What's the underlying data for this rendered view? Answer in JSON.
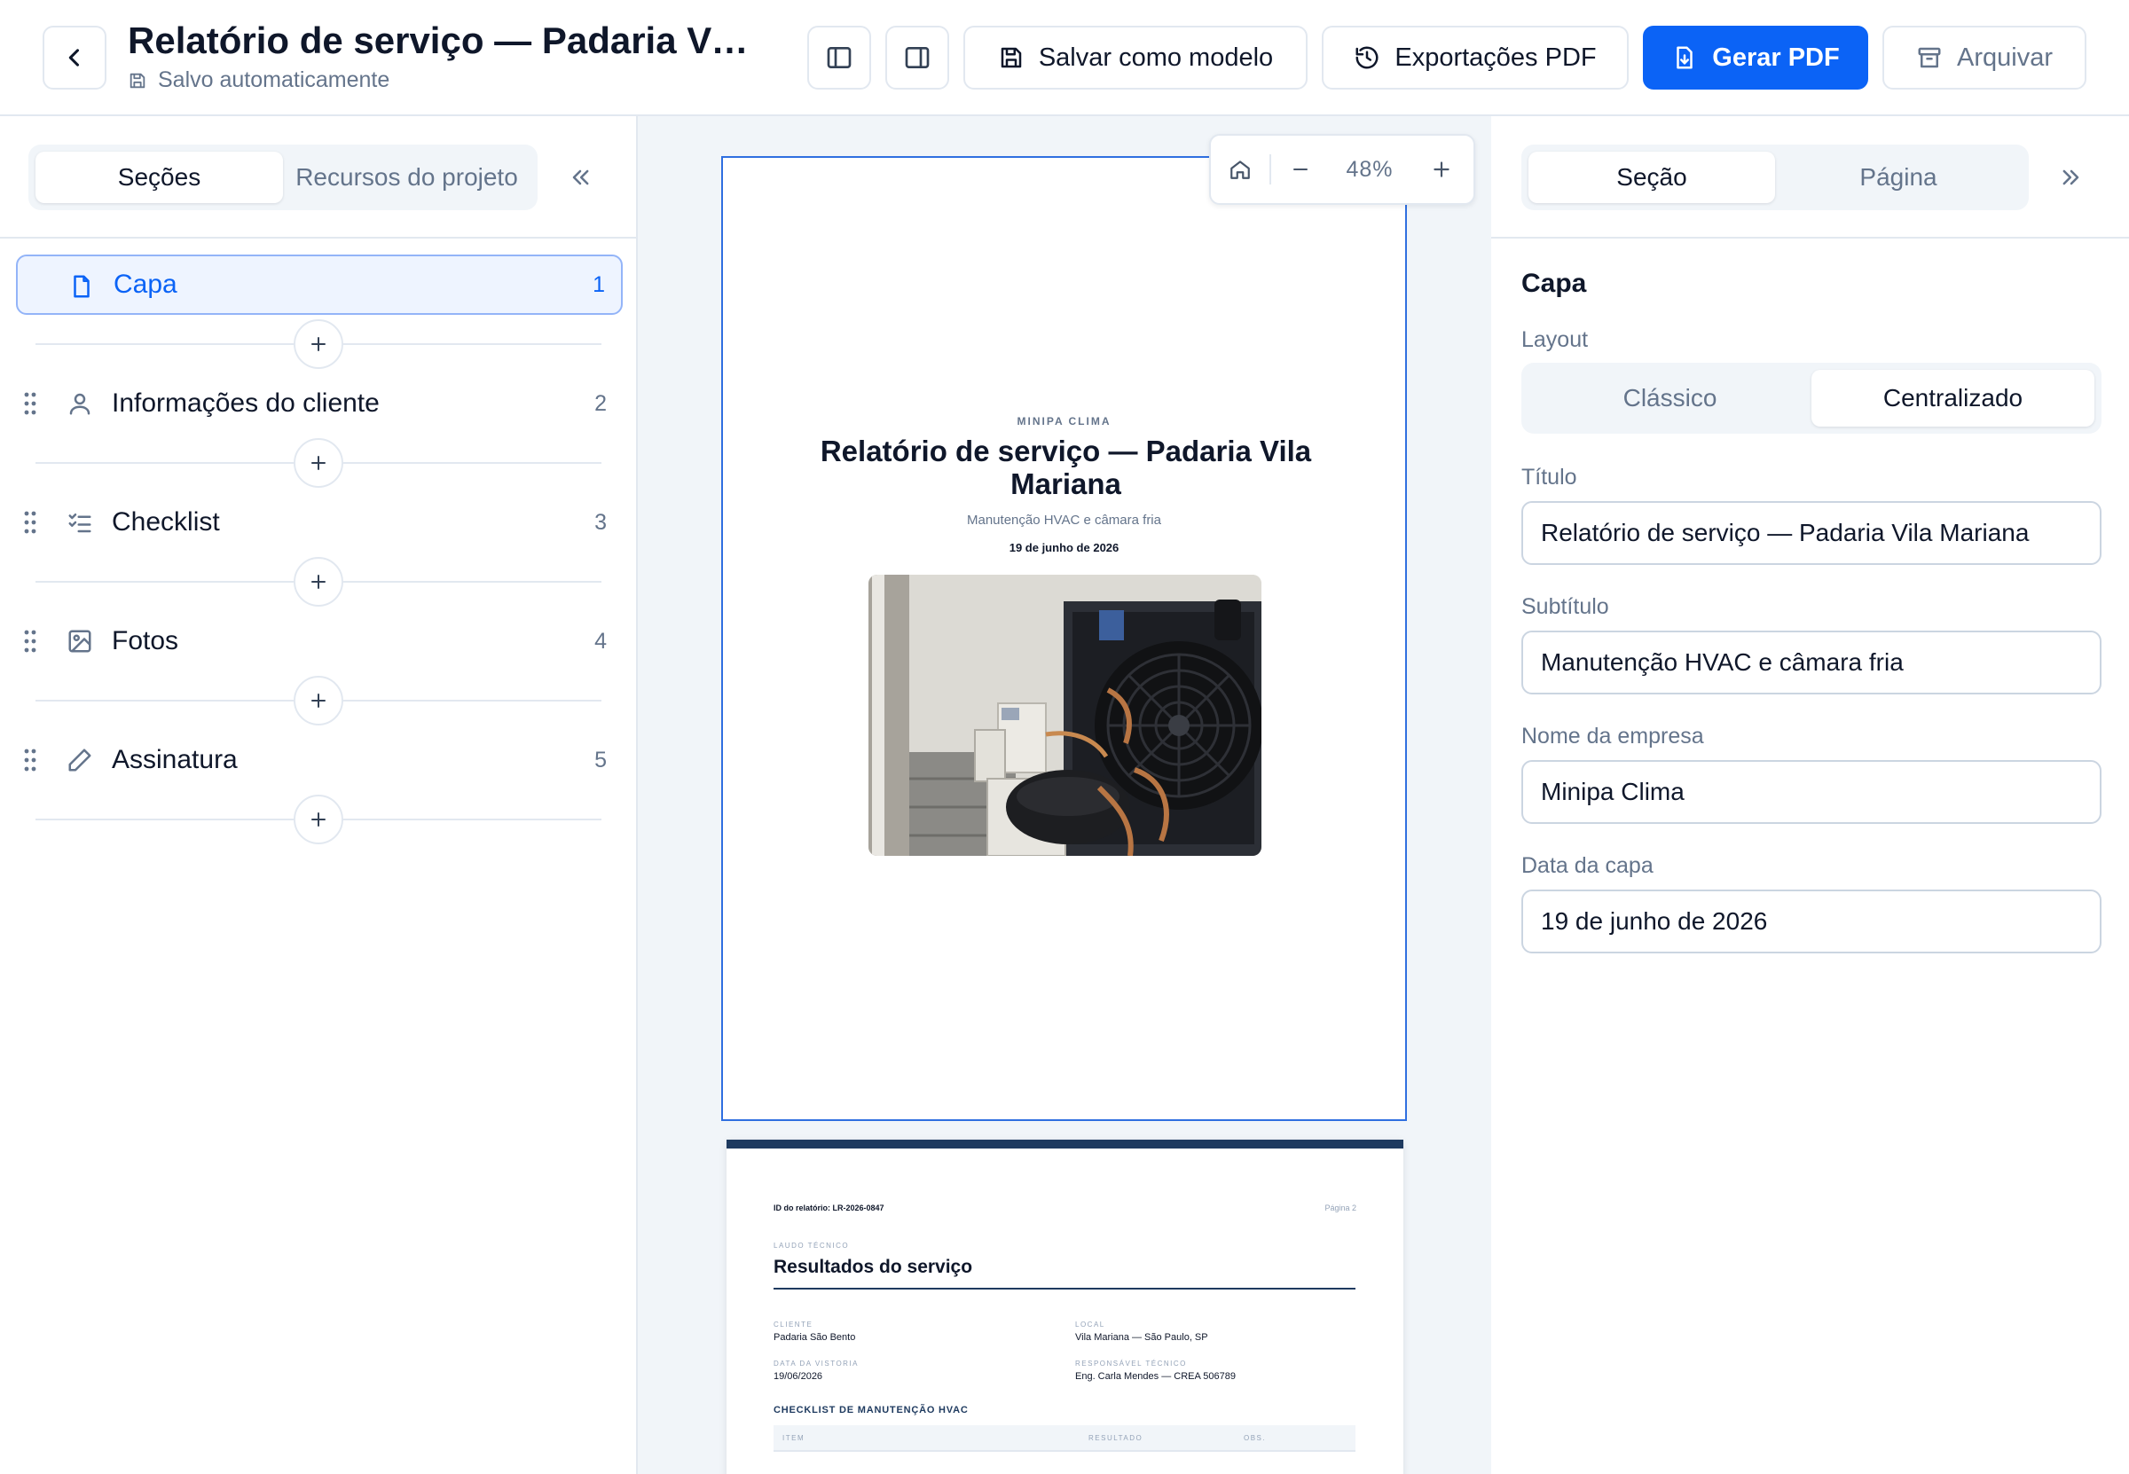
{
  "header": {
    "title": "Relatório de serviço — Padaria Vila Mariana",
    "autosave": "Salvo automaticamente",
    "save_template": "Salvar como modelo",
    "exports": "Exportações PDF",
    "generate": "Gerar PDF",
    "archive": "Arquivar",
    "primary_color": "#0b63f6"
  },
  "left": {
    "tabs": [
      "Seções",
      "Recursos do projeto"
    ],
    "active_tab": "Seções",
    "sections": [
      {
        "label": "Capa",
        "num": "1",
        "icon": "file-icon"
      },
      {
        "label": "Informações do cliente",
        "num": "2",
        "icon": "user-icon"
      },
      {
        "label": "Checklist",
        "num": "3",
        "icon": "checklist-icon"
      },
      {
        "label": "Fotos",
        "num": "4",
        "icon": "image-icon"
      },
      {
        "label": "Assinatura",
        "num": "5",
        "icon": "pencil-icon"
      }
    ]
  },
  "canvas": {
    "zoom": "48%",
    "cover": {
      "company": "MINIPA CLIMA",
      "title": "Relatório de serviço — Padaria Vila Mariana",
      "subtitle": "Manutenção HVAC e câmara fria",
      "date": "19 de junho de 2026"
    },
    "page2": {
      "report_id": "ID do relatório: LR-2026-0847",
      "page": "Página 2",
      "kicker": "LAUDO TÉCNICO",
      "heading": "Resultados do serviço",
      "client_label": "CLIENTE",
      "client": "Padaria São Bento",
      "local_label": "LOCAL",
      "local": "Vila Mariana — São Paulo, SP",
      "date_label": "DATA DA VISTORIA",
      "date": "19/06/2026",
      "tech_label": "RESPONSÁVEL TÉCNICO",
      "tech": "Eng. Carla Mendes — CREA 506789",
      "checklist_title": "CHECKLIST DE MANUTENÇÃO HVAC",
      "col_item": "ITEM",
      "col_result": "RESULTADO",
      "col_obs": "OBS.",
      "band_color": "#1e3a5f"
    }
  },
  "right": {
    "tabs": [
      "Seção",
      "Página"
    ],
    "active_tab": "Seção",
    "heading": "Capa",
    "layout_label": "Layout",
    "layout_options": [
      "Clássico",
      "Centralizado"
    ],
    "layout_selected": "Centralizado",
    "fields": {
      "title_label": "Título",
      "title_value": "Relatório de serviço — Padaria Vila Mariana",
      "subtitle_label": "Subtítulo",
      "subtitle_value": "Manutenção HVAC e câmara fria",
      "company_label": "Nome da empresa",
      "company_value": "Minipa Clima",
      "date_label": "Data da capa",
      "date_value": "19 de junho de 2026"
    }
  }
}
